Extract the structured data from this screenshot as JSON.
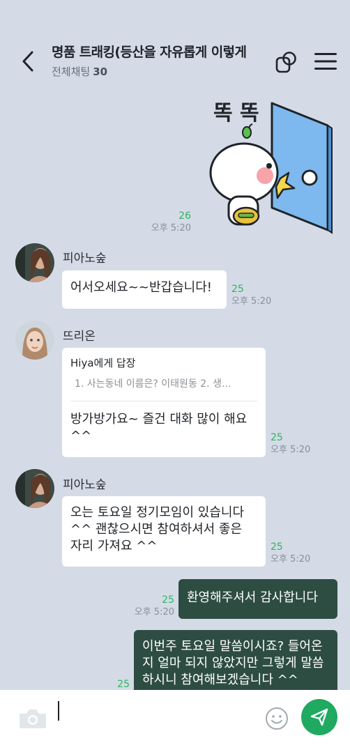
{
  "header": {
    "title": "명품 트래킹(등산을 자유롭게 이렇게",
    "subtitle_label": "전체채팅",
    "member_count": "30"
  },
  "sticker": {
    "text": "똑 똑",
    "count": "26",
    "time": "오후 5:20"
  },
  "messages": [
    {
      "sender": "피아노숲",
      "text": "어서오세요~~반갑습니다!",
      "count": "25",
      "time": "오후 5:20"
    },
    {
      "sender": "뜨리온",
      "reply_to": "Hiya에게 답장",
      "reply_quote": "1. 사는동네 이름은? 이태원동 2. 생...",
      "text": "방가방가요~ 즐건 대화 많이 해요 ^^",
      "count": "25",
      "time": "오후 5:20"
    },
    {
      "sender": "피아노숲",
      "text": "오는 토요일 정기모임이 있습니다 ^^ 괜찮으시면 참여하셔서 좋은 자리 가져요 ^^",
      "count": "25",
      "time": "오후 5:20"
    },
    {
      "sender": "me",
      "text": "환영해주셔서 감사합니다",
      "count": "25",
      "time": "오후 5:20"
    },
    {
      "sender": "me",
      "text": "이번주 토요일 말씀이시죠? 들어온지 얼마 되지 않았지만 그렇게 말씀하시니 참여해보겠습니다 ^^",
      "count": "25",
      "time": ""
    }
  ],
  "icons": {
    "back": "back-arrow-icon",
    "openchat": "openchat-icon",
    "menu": "menu-icon",
    "camera": "camera-icon",
    "emoji": "emoji-icon",
    "send": "send-icon"
  },
  "colors": {
    "background": "#d4dbe7",
    "my_bubble": "#2e4d42",
    "send_button": "#1fa961",
    "read_count": "#2fb55d"
  }
}
